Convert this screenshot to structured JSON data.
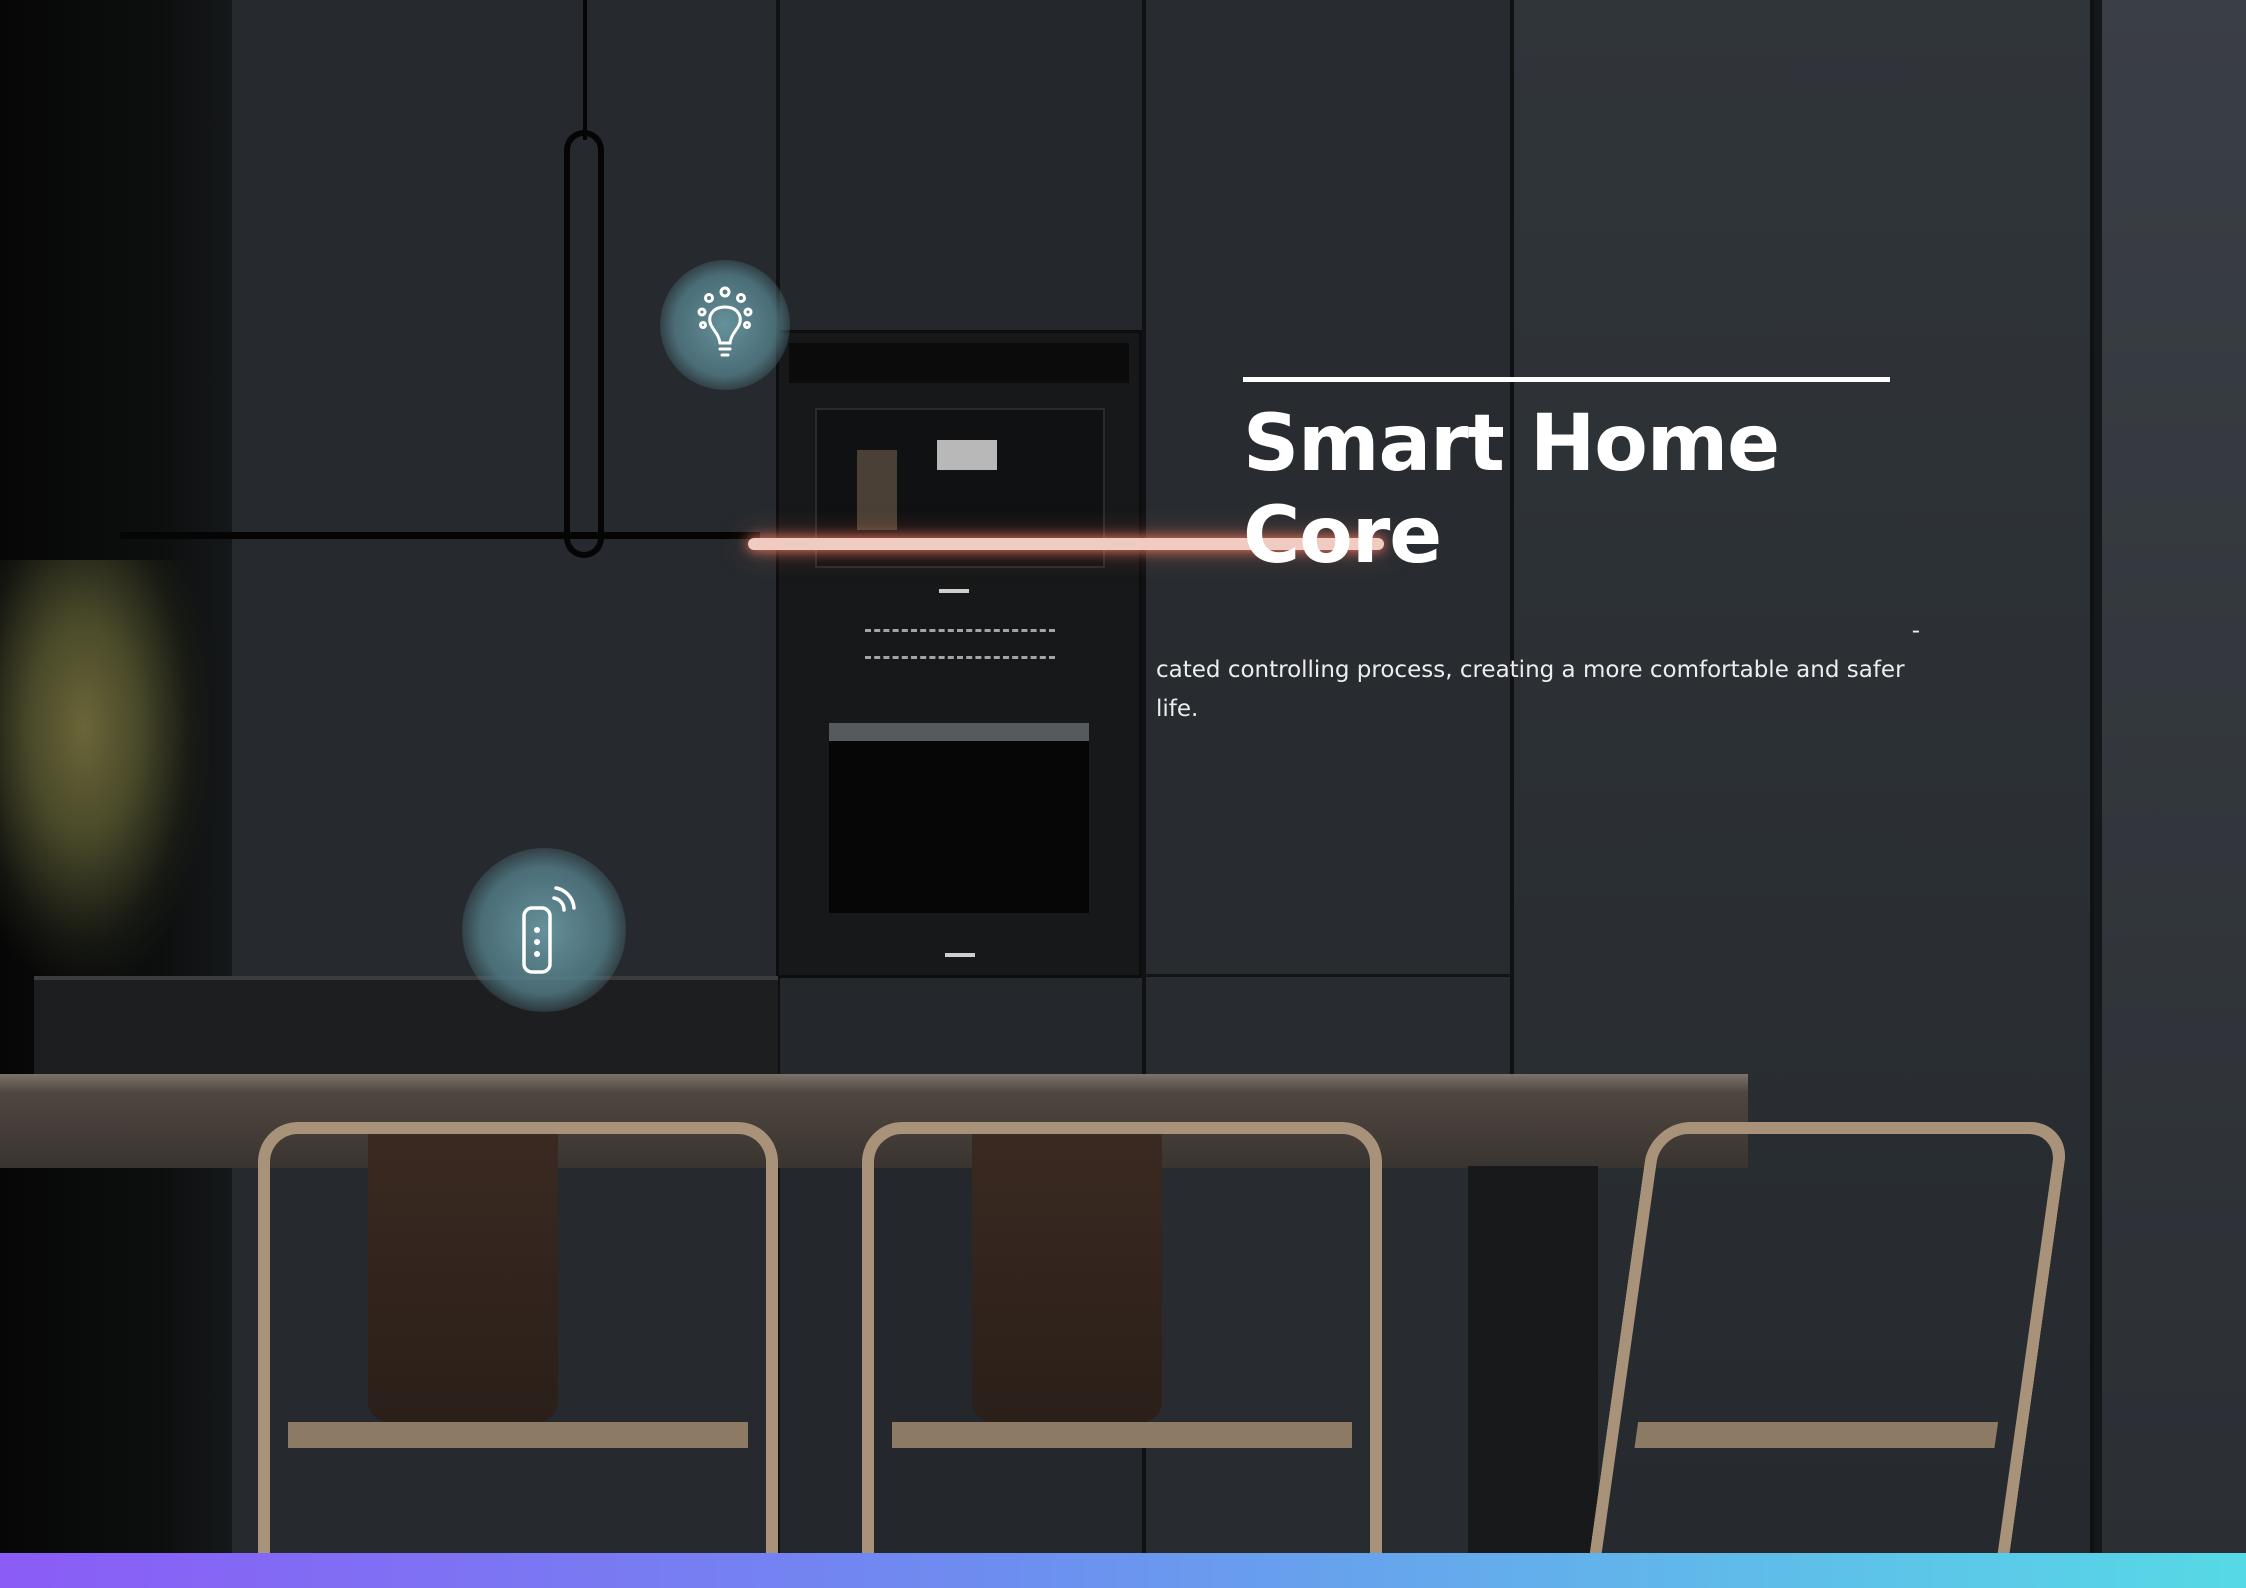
{
  "slide": {
    "title": "Smart Home Core",
    "body_line1": "-",
    "body_line2": "cated controlling process, creating a more comfortable and safer",
    "body_line3": "life."
  },
  "icons": {
    "bulb": "smart-bulb-icon",
    "remote": "smart-remote-icon"
  },
  "colors": {
    "accent_bar_start": "#8b5cf6",
    "accent_bar_end": "#56d9e6",
    "title": "#ffffff",
    "icon_glow": "#6a98a2"
  }
}
